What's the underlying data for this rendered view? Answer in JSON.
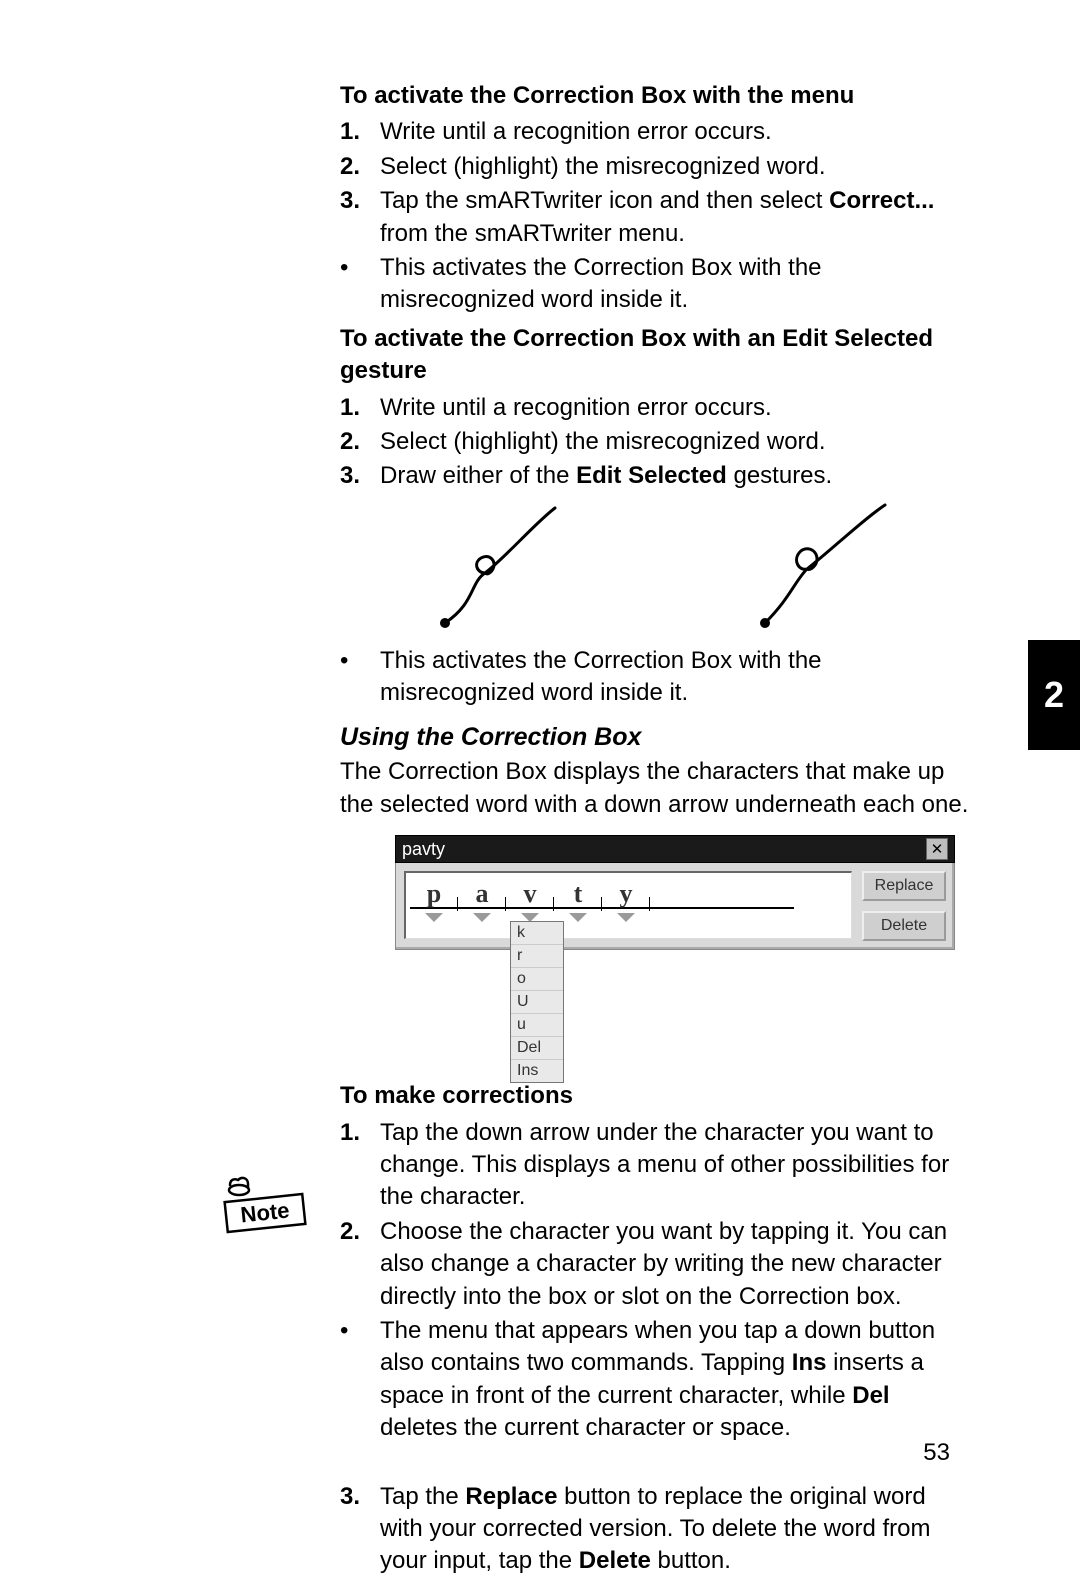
{
  "chapter_tab": "2",
  "page_number": "53",
  "section1": {
    "title": "To activate the Correction Box with the menu",
    "steps": [
      "Write until a recognition error occurs.",
      "Select (highlight) the misrecognized word."
    ],
    "step3_prefix": "Tap the smARTwriter icon and then select ",
    "step3_bold": "Correct...",
    "step3_suffix": " from the smARTwriter menu.",
    "bullet": "This activates the Correction Box with the misrecognized word inside it."
  },
  "section2": {
    "title": "To activate the Correction Box with an Edit Selected gesture",
    "steps": [
      "Write until a recognition error occurs.",
      "Select (highlight) the misrecognized word."
    ],
    "step3_prefix": "Draw either of the ",
    "step3_bold": "Edit Selected",
    "step3_suffix": " gestures.",
    "bullet": "This activates the Correction Box with the misrecognized word inside it."
  },
  "section3": {
    "title": "Using the Correction Box",
    "intro": "The Correction Box displays the characters that make up the selected word with a down arrow underneath each one."
  },
  "correction_box": {
    "title_word": "pavty",
    "chars": [
      "p",
      "a",
      "v",
      "t",
      "y"
    ],
    "empty_slots": 4,
    "dropdown_options": [
      "k",
      "r",
      "o",
      "U",
      "u",
      "Del",
      "Ins"
    ],
    "buttons": {
      "replace": "Replace",
      "delete": "Delete"
    }
  },
  "section4": {
    "title": "To make corrections",
    "step1": "Tap the down arrow under the character you want to change. This displays a menu of other possibilities for the character.",
    "step2": "Choose the character you want by tapping it. You can also change a character by writing the new character directly into the box or slot on the Correction box.",
    "note_prefix": "The menu that appears when you tap a down button also contains two commands. Tapping ",
    "note_ins": "Ins",
    "note_mid": " inserts a space in front of the current character, while ",
    "note_del": "Del",
    "note_suffix": " deletes the current character or space.",
    "step3_a": "Tap the ",
    "step3_replace": "Replace",
    "step3_b": " button to replace the original word with your corrected version. To delete the word from your input, tap the ",
    "step3_delete": "Delete",
    "step3_c": " button."
  },
  "note_label": "Note"
}
